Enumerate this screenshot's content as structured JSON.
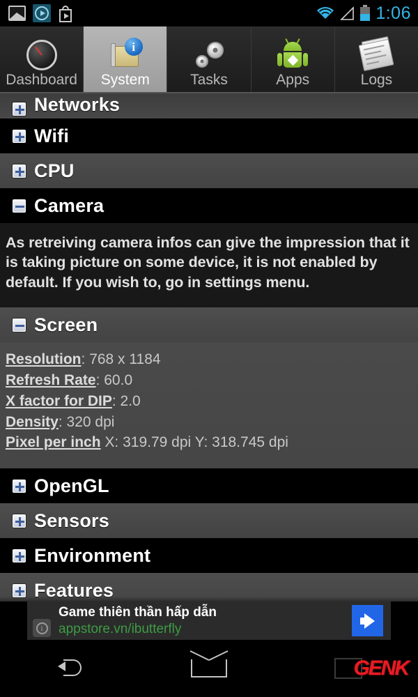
{
  "status_bar": {
    "icons": [
      "gallery-icon",
      "music-player-icon",
      "play-store-icon"
    ],
    "wifi_icon": "wifi-icon",
    "signal_icon": "cell-signal-icon",
    "battery_icon": "battery-icon",
    "time": "1:06",
    "accent_color": "#33b5e5"
  },
  "tabs": [
    {
      "label": "Dashboard",
      "icon": "gauge-icon",
      "active": false
    },
    {
      "label": "System",
      "icon": "system-board-info-icon",
      "active": true
    },
    {
      "label": "Tasks",
      "icon": "gears-icon",
      "active": false
    },
    {
      "label": "Apps",
      "icon": "android-robot-icon",
      "active": false
    },
    {
      "label": "Logs",
      "icon": "newspaper-icon",
      "active": false
    }
  ],
  "sections": [
    {
      "title": "Networks",
      "state": "collapsed"
    },
    {
      "title": "Wifi",
      "state": "collapsed"
    },
    {
      "title": "CPU",
      "state": "collapsed"
    },
    {
      "title": "Camera",
      "state": "expanded"
    },
    {
      "title": "Screen",
      "state": "expanded"
    },
    {
      "title": "OpenGL",
      "state": "collapsed"
    },
    {
      "title": "Sensors",
      "state": "collapsed"
    },
    {
      "title": "Environment",
      "state": "collapsed"
    },
    {
      "title": "Features",
      "state": "collapsed"
    }
  ],
  "camera": {
    "message": "As retreiving camera infos can give the impression that it is taking picture on some device, it is not enabled by default. If you wish to, go in settings menu."
  },
  "screen_info": [
    {
      "key": "Resolution",
      "sep": ":",
      "value": "768 x 1184"
    },
    {
      "key": "Refresh Rate",
      "sep": ":",
      "value": "60.0"
    },
    {
      "key": "X factor for DIP",
      "sep": ":",
      "value": "2.0"
    },
    {
      "key": "Density",
      "sep": ":",
      "value": "320 dpi"
    },
    {
      "key": "Pixel per inch",
      "sep": "",
      "value": "X: 319.79 dpi Y: 318.745 dpi"
    }
  ],
  "ad": {
    "title": "Game thiên thần hấp dẫn",
    "url": "appstore.vn/ibutterfly",
    "info_icon": "info-icon",
    "cta_icon": "arrow-right-icon",
    "cta_color": "#2266e8",
    "url_color": "#3c9c44"
  },
  "nav_bar": {
    "back": "back-icon",
    "home": "home-icon",
    "recents": "recents-icon",
    "watermark": "GENK",
    "watermark_color": "#e81b23"
  }
}
